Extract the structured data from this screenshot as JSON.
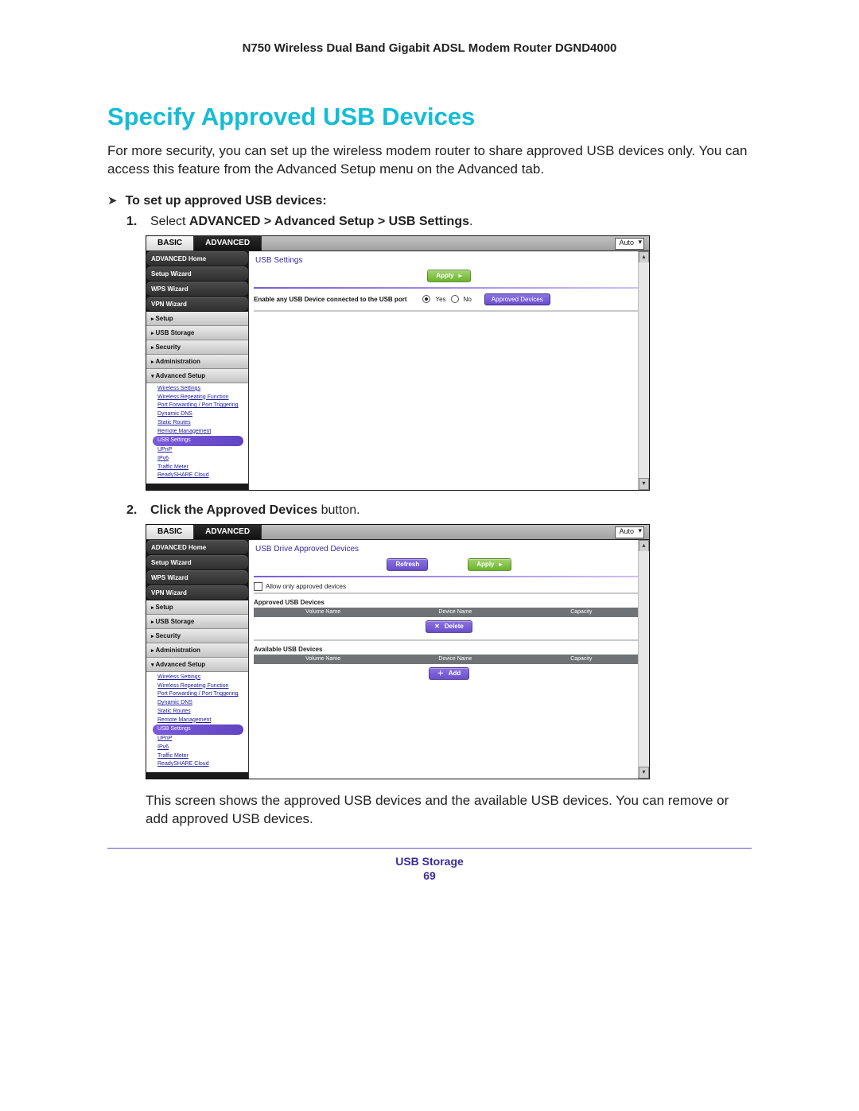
{
  "doc_header": "N750 Wireless Dual Band Gigabit ADSL Modem Router DGND4000",
  "section_title": "Specify Approved USB Devices",
  "intro": "For more security, you can set up the wireless modem router to share approved USB devices only. You can access this feature from the Advanced Setup menu on the Advanced tab.",
  "lead": "To set up approved USB devices:",
  "step1_prefix": "Select ",
  "step1_bold": "ADVANCED > Advanced Setup > USB Settings",
  "step1_suffix": ".",
  "step2_prefix": "Click the ",
  "step2_bold": "Approved Devices",
  "step2_suffix": " button.",
  "outro": "This screen shows the approved USB devices and the available USB devices. You can remove or add approved USB devices.",
  "tabs": {
    "basic": "BASIC",
    "advanced": "ADVANCED",
    "lang": "Auto"
  },
  "sidebar": {
    "main": [
      "ADVANCED Home",
      "Setup Wizard",
      "WPS Wizard",
      "VPN Wizard"
    ],
    "sections": [
      "Setup",
      "USB Storage",
      "Security",
      "Administration",
      "Advanced Setup"
    ],
    "subs": [
      "Wireless Settings",
      "Wireless Repeating Function",
      "Port Forwarding / Port Triggering",
      "Dynamic DNS",
      "Static Routes",
      "Remote Management",
      "USB Settings",
      "UPnP",
      "IPv6",
      "Traffic Meter",
      "ReadySHARE Cloud"
    ]
  },
  "screen1": {
    "title": "USB Settings",
    "apply": "Apply",
    "enable_label": "Enable any USB Device connected to the USB port",
    "yes": "Yes",
    "no": "No",
    "approved_btn": "Approved Devices"
  },
  "screen2": {
    "title": "USB Drive Approved Devices",
    "refresh": "Refresh",
    "apply": "Apply",
    "allow_only": "Allow only approved devices",
    "approved_label": "Approved USB Devices",
    "available_label": "Available USB Devices",
    "cols": {
      "vol": "Volume Name",
      "dev": "Device Name",
      "cap": "Capacity"
    },
    "delete": "Delete",
    "add": "Add"
  },
  "footer": {
    "section": "USB Storage",
    "page": "69"
  }
}
